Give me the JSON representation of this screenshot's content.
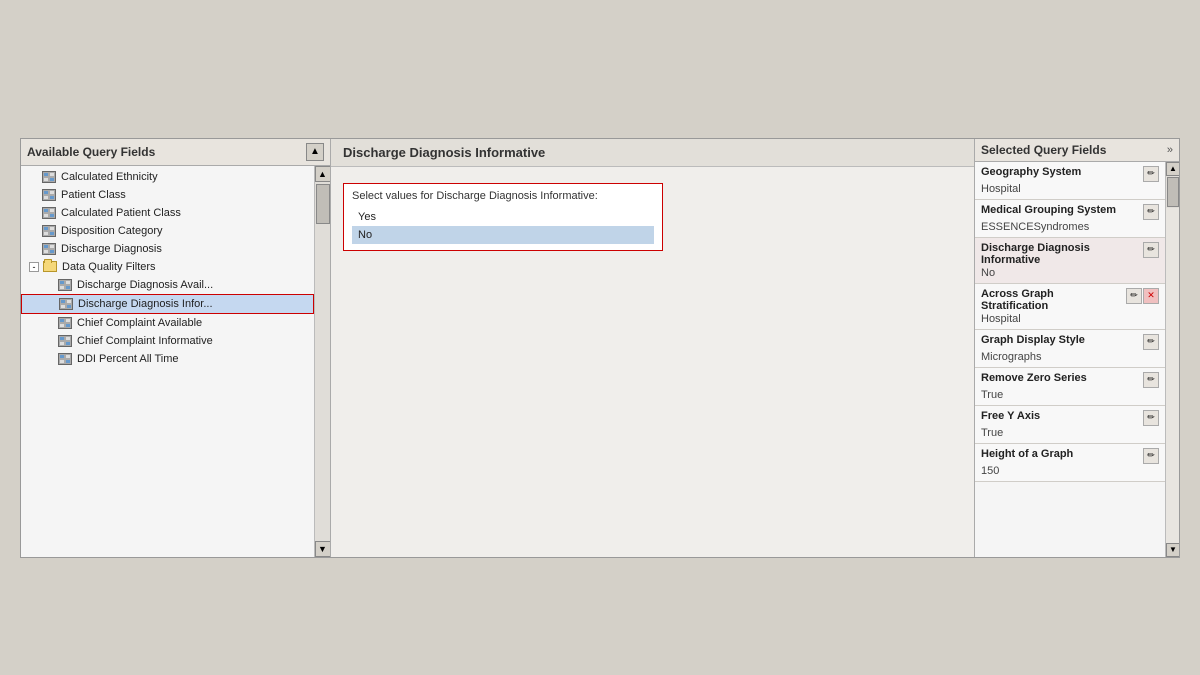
{
  "leftPanel": {
    "title": "Available Query Fields",
    "items": [
      {
        "id": "calculated-ethnicity",
        "label": "Calculated Ethnicity",
        "indent": "indent1",
        "type": "grid"
      },
      {
        "id": "patient-class",
        "label": "Patient Class",
        "indent": "indent1",
        "type": "grid"
      },
      {
        "id": "calculated-patient-class",
        "label": "Calculated Patient Class",
        "indent": "indent1",
        "type": "grid"
      },
      {
        "id": "disposition-category",
        "label": "Disposition Category",
        "indent": "indent1",
        "type": "grid"
      },
      {
        "id": "discharge-diagnosis",
        "label": "Discharge Diagnosis",
        "indent": "indent1",
        "type": "grid"
      },
      {
        "id": "data-quality-filters",
        "label": "Data Quality Filters",
        "indent": "indent0",
        "type": "folder",
        "expanded": true
      },
      {
        "id": "discharge-diagnosis-avail",
        "label": "Discharge Diagnosis Avail...",
        "indent": "indent2",
        "type": "grid"
      },
      {
        "id": "discharge-diagnosis-infor",
        "label": "Discharge Diagnosis Infor...",
        "indent": "indent2",
        "type": "grid",
        "selected": true
      },
      {
        "id": "chief-complaint-available",
        "label": "Chief Complaint Available",
        "indent": "indent2",
        "type": "grid"
      },
      {
        "id": "chief-complaint-informative",
        "label": "Chief Complaint Informative",
        "indent": "indent2",
        "type": "grid"
      },
      {
        "id": "ddi-percent-all-time",
        "label": "DDI Percent All Time",
        "indent": "indent2",
        "type": "grid"
      }
    ]
  },
  "centerPanel": {
    "title": "Discharge Diagnosis Informative",
    "selectLabel": "Select values for Discharge Diagnosis Informative:",
    "options": [
      {
        "label": "Yes",
        "selected": false
      },
      {
        "label": "No",
        "selected": true
      }
    ]
  },
  "rightPanel": {
    "title": "Selected Query Fields",
    "fields": [
      {
        "name": "Geography System",
        "value": "Hospital",
        "highlighted": false,
        "hasEdit": true,
        "hasDelete": false,
        "hasX": false
      },
      {
        "name": "Medical Grouping System",
        "value": "ESSENCESyndromes",
        "highlighted": false,
        "hasEdit": true,
        "hasDelete": false,
        "hasX": false
      },
      {
        "name": "Discharge Diagnosis Informative",
        "value": "No",
        "highlighted": true,
        "hasEdit": true,
        "hasDelete": false,
        "hasX": false
      },
      {
        "name": "Across Graph Stratification",
        "value": "Hospital",
        "highlighted": false,
        "hasEdit": true,
        "hasDelete": false,
        "hasX": true
      },
      {
        "name": "Graph Display Style",
        "value": "Micrographs",
        "highlighted": false,
        "hasEdit": true,
        "hasDelete": false,
        "hasX": false
      },
      {
        "name": "Remove Zero Series",
        "value": "True",
        "highlighted": false,
        "hasEdit": true,
        "hasDelete": false,
        "hasX": false
      },
      {
        "name": "Free Y Axis",
        "value": "True",
        "highlighted": false,
        "hasEdit": true,
        "hasDelete": false,
        "hasX": false
      },
      {
        "name": "Height of a Graph",
        "value": "150",
        "highlighted": false,
        "hasEdit": true,
        "hasDelete": false,
        "hasX": false
      }
    ]
  }
}
